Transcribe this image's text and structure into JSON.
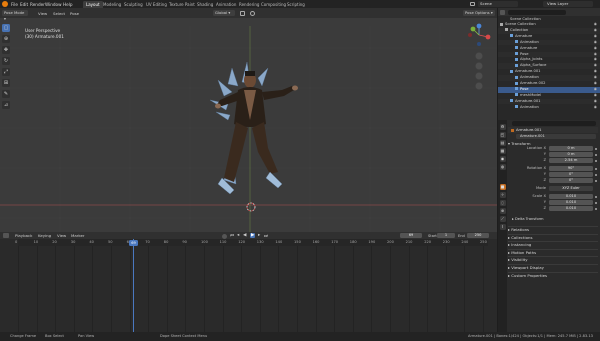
{
  "menu": [
    "File",
    "Edit",
    "Render",
    "Window",
    "Help"
  ],
  "workspace_tabs": [
    "Layout",
    "Modeling",
    "Sculpting",
    "UV Editing",
    "Texture Paint",
    "Shading",
    "Animation",
    "Rendering",
    "Compositing",
    "Scripting"
  ],
  "active_tab": "Layout",
  "scene": "Scene",
  "view_layer": "View Layer",
  "viewport": {
    "mode": "Pose Mode",
    "menus": [
      "View",
      "Select",
      "Pose"
    ],
    "orientation": "Global",
    "options": "Pose Options",
    "overlay_title": "User Perspective",
    "overlay_object": "(30) Armature.001"
  },
  "timeline": {
    "menus": [
      "Playback",
      "Keying",
      "View",
      "Marker"
    ],
    "current_frame": "69",
    "start_label": "Start",
    "start": "1",
    "end_label": "End",
    "end": "250",
    "ruler": [
      "0",
      "10",
      "20",
      "30",
      "40",
      "50",
      "60",
      "70",
      "80",
      "90",
      "100",
      "110",
      "120",
      "130",
      "140",
      "150",
      "160",
      "170",
      "180",
      "190",
      "200",
      "210",
      "220",
      "230",
      "240",
      "250"
    ]
  },
  "outliner": {
    "title": "Scene Collection",
    "rows": [
      {
        "text": "Scene Collection",
        "indent": 0
      },
      {
        "text": "Collection",
        "indent": 1
      },
      {
        "text": "Armature",
        "indent": 2
      },
      {
        "text": "Animation",
        "indent": 3
      },
      {
        "text": "Armature",
        "indent": 3
      },
      {
        "text": "Pose",
        "indent": 3
      },
      {
        "text": "Alpha_Joints",
        "indent": 3
      },
      {
        "text": "Alpha_Surface",
        "indent": 3
      },
      {
        "text": "Armature.001",
        "indent": 2
      },
      {
        "text": "Animation",
        "indent": 3
      },
      {
        "text": "Armature.002",
        "indent": 3
      },
      {
        "text": "Pose",
        "indent": 3
      },
      {
        "text": "meshModel",
        "indent": 3
      },
      {
        "text": "Armature.001",
        "indent": 2
      },
      {
        "text": "Animation",
        "indent": 3
      }
    ],
    "selected_index": 11
  },
  "properties": {
    "object_name": "Armature.001",
    "data_name": "Armature.001",
    "section": "Transform",
    "location_label": "Location X",
    "location": [
      "0 m",
      "0 m",
      "2.54 m"
    ],
    "rotation_label": "Rotation X",
    "rotation": [
      "90°",
      "0°",
      "0°"
    ],
    "mode_label": "Mode",
    "mode": "XYZ Euler",
    "scale_label": "Scale X",
    "scale": [
      "0.010",
      "0.010",
      "0.010"
    ],
    "axis_y": "Y",
    "axis_z": "Z",
    "delta": "Delta Transform",
    "sections": [
      "Relations",
      "Collections",
      "Instancing",
      "Motion Paths",
      "Visibility",
      "Viewport Display",
      "Custom Properties"
    ]
  },
  "status": {
    "left": [
      "Change Frame",
      "Box Select",
      "Pan View"
    ],
    "middle": "Dope Sheet Context Menu",
    "right": "Armature.001 | Bones:1/424 | Objects:1/1 | Mem: 245.7 MiB | 2.83.13"
  },
  "colors": {
    "accent": "#4772b3",
    "select": "#4a78c0",
    "bone": "#8aa8c9"
  }
}
